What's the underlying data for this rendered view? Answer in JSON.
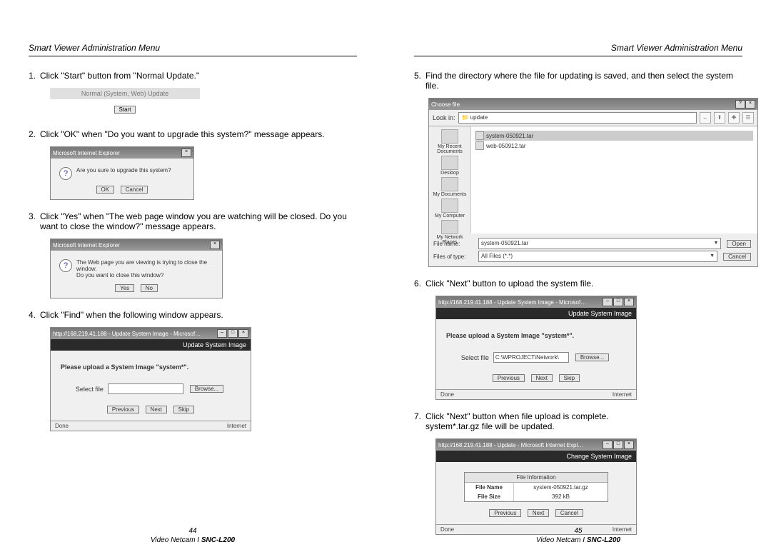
{
  "header_title": "Smart Viewer Administration Menu",
  "left": {
    "s1": {
      "n": "1.",
      "t": "Click \"Start\" button from \"Normal Update.\""
    },
    "normal_hdr": "Normal (System, Web) Update",
    "start_btn": "Start",
    "s2": {
      "n": "2.",
      "t": "Click \"OK\" when \"Do you want to upgrade this system?\" message appears."
    },
    "alert1": {
      "title": "Microsoft Internet Explorer",
      "msg": "Are you sure to upgrade this system?",
      "ok": "OK",
      "cancel": "Cancel"
    },
    "s3": {
      "n": "3.",
      "t": "Click \"Yes\" when \"The web page window you are watching will be closed.  Do you want to close the window?\" message appears."
    },
    "alert2": {
      "title": "Microsoft Internet Explorer",
      "msg1": "The Web page you are viewing is trying to close the window.",
      "msg2": "Do you want to close this window?",
      "yes": "Yes",
      "no": "No"
    },
    "s4": {
      "n": "4.",
      "t": "Click \"Find\" when the following window appears."
    },
    "up1": {
      "title": "http://168.219.41.188 - Update System Image - Microsof…",
      "subheader": "Update System Image",
      "msg": "Please upload a System Image \"system*\".",
      "select_label": "Select file",
      "file_value": "",
      "browse": "Browse...",
      "prev": "Previous",
      "next": "Next",
      "skip": "Skip",
      "done": "Done",
      "internet": "Internet"
    },
    "pagenum": "44"
  },
  "right": {
    "s5": {
      "n": "5.",
      "t": "Find the directory where the file for updating is saved, and then select the system file."
    },
    "choose": {
      "title": "Choose file",
      "lookin_lbl": "Look in:",
      "lookin_val": "update",
      "entries": [
        "system-050921.tar",
        "web-050912.tar"
      ],
      "side": [
        "My Recent Documents",
        "Desktop",
        "My Documents",
        "My Computer",
        "My Network Places"
      ],
      "fname_lbl": "File name:",
      "fname_val": "system-050921.tar",
      "ftype_lbl": "Files of type:",
      "ftype_val": "All Files (*.*)",
      "open": "Open",
      "cancel": "Cancel"
    },
    "s6": {
      "n": "6.",
      "t": "Click \"Next\" button to upload the system file."
    },
    "up2": {
      "title": "http://168.219.41.188 - Update System Image - Microsof…",
      "subheader": "Update System Image",
      "msg": "Please upload a System Image \"system*\".",
      "select_label": "Select file",
      "file_value": "C:\\WPROJECT\\Network\\",
      "browse": "Browse...",
      "prev": "Previous",
      "next": "Next",
      "skip": "Skip",
      "done": "Done",
      "internet": "Internet"
    },
    "s7": {
      "n": "7.",
      "t": "Click \"Next\" button when file upload is complete.",
      "t2": "system*.tar.gz file will be updated."
    },
    "up3": {
      "title": "http://168.219.41.188 - Update - Microsoft Internet Expl…",
      "subheader": "Change System Image",
      "info_hdr": "File Information",
      "row1_k": "File Name",
      "row1_v": "system-050921.tar.gz",
      "row2_k": "File Size",
      "row2_v": "392 kB",
      "prev": "Previous",
      "next": "Next",
      "cancel": "Cancel",
      "done": "Done",
      "internet": "Internet"
    },
    "pagenum": "45"
  },
  "footer": {
    "model_pre": "Video Netcam I ",
    "model": "SNC-L200"
  }
}
